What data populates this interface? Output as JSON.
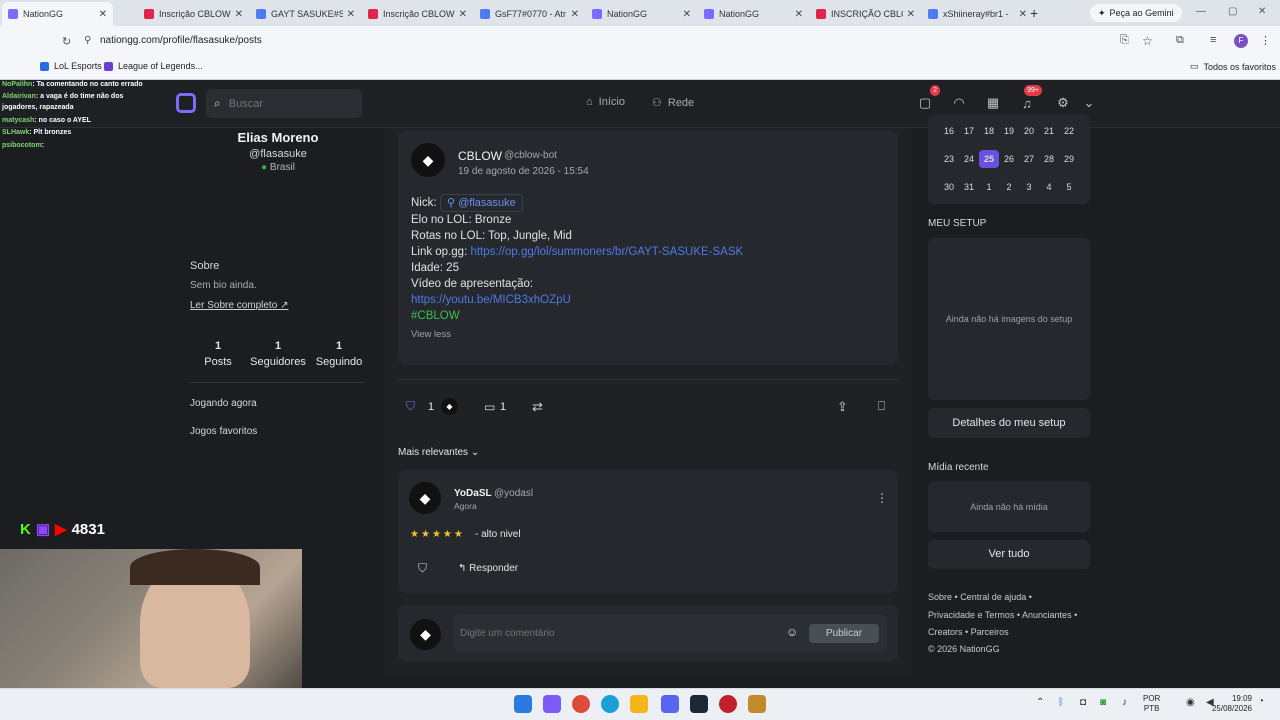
{
  "browser": {
    "tabs": [
      {
        "label": "NationGG",
        "color": "#7b6cff",
        "active": true
      },
      {
        "label": "Inscrição CBLOW",
        "color": "#e0254a"
      },
      {
        "label": "GAYT SASUKE#SA",
        "color": "#4a7cf0"
      },
      {
        "label": "Inscrição CBLOW",
        "color": "#e0254a"
      },
      {
        "label": "GsF77#0770 - Atr",
        "color": "#4a7cf0"
      },
      {
        "label": "NationGG",
        "color": "#7b6cff"
      },
      {
        "label": "NationGG",
        "color": "#7b6cff"
      },
      {
        "label": "INSCRIÇÃO CBLO",
        "color": "#e0254a"
      },
      {
        "label": "xShiineray#br1 -",
        "color": "#4a7cf0"
      }
    ],
    "gemini_label": "Peça ao Gemini",
    "url": "nationgg.com/profile/flasasuke/posts",
    "bookmarks": {
      "item1": "LoL Esports",
      "item2": "League of Legends...",
      "all": "Todos os favoritos"
    }
  },
  "header": {
    "search_placeholder": "Buscar",
    "nav": {
      "home": "Início",
      "network": "Rede"
    },
    "badges": {
      "messages": "2",
      "notifications": "99+"
    }
  },
  "profile": {
    "name": "Elias Moreno",
    "handle": "@flasasuke",
    "country": "Brasil",
    "about_title": "Sobre",
    "bio": "Sem bio ainda.",
    "read_more": "Ler Sobre completo",
    "stats": [
      {
        "value": "1",
        "label": "Posts"
      },
      {
        "value": "1",
        "label": "Seguidores"
      },
      {
        "value": "1",
        "label": "Seguindo"
      }
    ],
    "playing_now": "Jogando agora",
    "favorite_games": "Jogos favoritos"
  },
  "post": {
    "author": "CBLOW",
    "author_handle": "@cblow-bot",
    "date": "19 de agosto de 2026 - 15:54",
    "nick_label": "Nick:",
    "nick_mention": "@flasasuke",
    "elo": "Elo no LOL: Bronze",
    "roles": "Rotas no LOL: Top, Jungle, Mid",
    "opgg_label": "Link op.gg:",
    "opgg_link": "https://op.gg/lol/summoners/br/GAYT-SASUKE-SASK",
    "age": "Idade: 25",
    "video_label": "Vídeo de apresentação:",
    "video_link": "https://youtu.be/MICB3xhOZpU",
    "hashtag": "#CBLOW",
    "view_less": "View less",
    "likes": "1",
    "comments": "1"
  },
  "comments_section": {
    "sort_label": "Mais relevantes",
    "comment": {
      "author": "YoDaSL",
      "handle": "@yodasl",
      "time": "Agora",
      "stars": 5,
      "text": "- alto nivel",
      "reply": "Responder"
    },
    "input_placeholder": "Digite um comentário",
    "publish": "Publicar"
  },
  "sidebar_right": {
    "calendar_rows": [
      [
        "16",
        "17",
        "18",
        "19",
        "20",
        "21",
        "22"
      ],
      [
        "23",
        "24",
        "25",
        "26",
        "27",
        "28",
        "29"
      ],
      [
        "30",
        "31",
        "1",
        "2",
        "3",
        "4",
        "5"
      ]
    ],
    "calendar_today": "25",
    "setup_title": "MEU SETUP",
    "setup_empty": "Ainda não há imagens do setup",
    "setup_details": "Detalhes do meu setup",
    "media_title": "Mídia recente",
    "media_empty": "Ainda não há mídia",
    "see_all": "Ver tudo",
    "footer": {
      "about": "Sobre",
      "help": "Central de ajuda",
      "privacy": "Privacidade e Termos",
      "advertisers": "Anunciantes",
      "creators": "Creators",
      "partners": "Parceiros",
      "copyright": "© 2026 NationGG"
    }
  },
  "stream_overlay": {
    "chat": [
      {
        "user": "NoPalihn",
        "msg": ": Ta comentando no canto errado"
      },
      {
        "user": "Aldairivan",
        "msg": ": a vaga é do time não dos"
      },
      {
        "user": "",
        "msg": "jogadores, rapazeada"
      },
      {
        "user": "matycash",
        "msg": ": no caso o AYEL"
      },
      {
        "user": "SLHawk",
        "msg": ": Plt bronzes"
      },
      {
        "user": "psibocotom",
        "msg": ":"
      }
    ],
    "viewers": "4831"
  },
  "taskbar": {
    "lang1": "POR",
    "lang2": "PTB",
    "time": "19:09",
    "date": "25/08/2026"
  }
}
